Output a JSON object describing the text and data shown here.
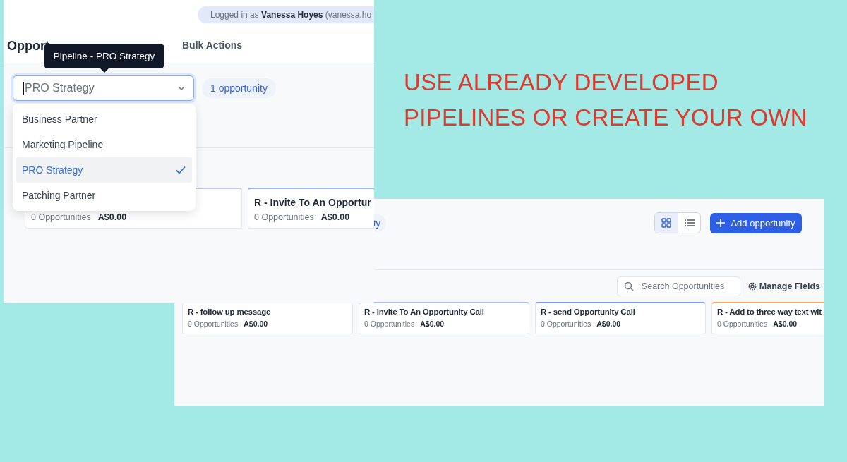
{
  "heading": {
    "lines": [
      "USE ALREADY DEVELOPED",
      "PIPELINES OR CREATE YOUR OWN"
    ]
  },
  "pipeline_screen": {
    "login_banner": "Logged in as **Vanessa Hoyes** (vanessa.ho",
    "page_title": "Opport",
    "tabs": [
      {
        "label": "Bulk Actions",
        "selected": false
      }
    ],
    "tooltip": "Pipeline - PRO Strategy",
    "pipeline_select": {
      "value": "PRO Strategy",
      "expanded": true
    },
    "count_badge": "1 opportunity",
    "pipeline_options": [
      {
        "label": "Business Partner",
        "selected": false
      },
      {
        "label": "Marketing Pipeline",
        "selected": false
      },
      {
        "label": "PRO Strategy",
        "selected": true
      },
      {
        "label": "Patching Partner",
        "selected": false
      }
    ],
    "stage_cards": [
      {
        "count": "0 Opportunities",
        "amount": "A$0.00",
        "color": "#c9c3ef"
      },
      {
        "title": "R - Invite To An Opportur",
        "count": "0 Opportunities",
        "amount": "A$0.00",
        "color": "#9db4f5"
      }
    ]
  },
  "board_screen": {
    "count_badge": "ty",
    "views": [
      {
        "kind": "grid",
        "selected": true
      },
      {
        "kind": "list",
        "selected": false
      }
    ],
    "add_button": "Add opportunity",
    "search": {
      "placeholder": "Search Opportunities"
    },
    "manage_fields": "Manage Fields",
    "stage_cards": [
      {
        "title": "R - follow up message",
        "count": "0 Opportunities",
        "amount": "A$0.00",
        "color": "#e5e7eb"
      },
      {
        "title": "R - Invite To An Opportunity Call",
        "count": "0 Opportunities",
        "amount": "A$0.00",
        "color": "#a9bdf2"
      },
      {
        "title": "R - send Opportunity Call",
        "count": "0 Opportunities",
        "amount": "A$0.00",
        "color": "#7f9ef0"
      },
      {
        "title": "R - Add to three way text wit",
        "count": "0 Opportunities",
        "amount": "A$0.00",
        "color": "#f2a765"
      }
    ]
  }
}
